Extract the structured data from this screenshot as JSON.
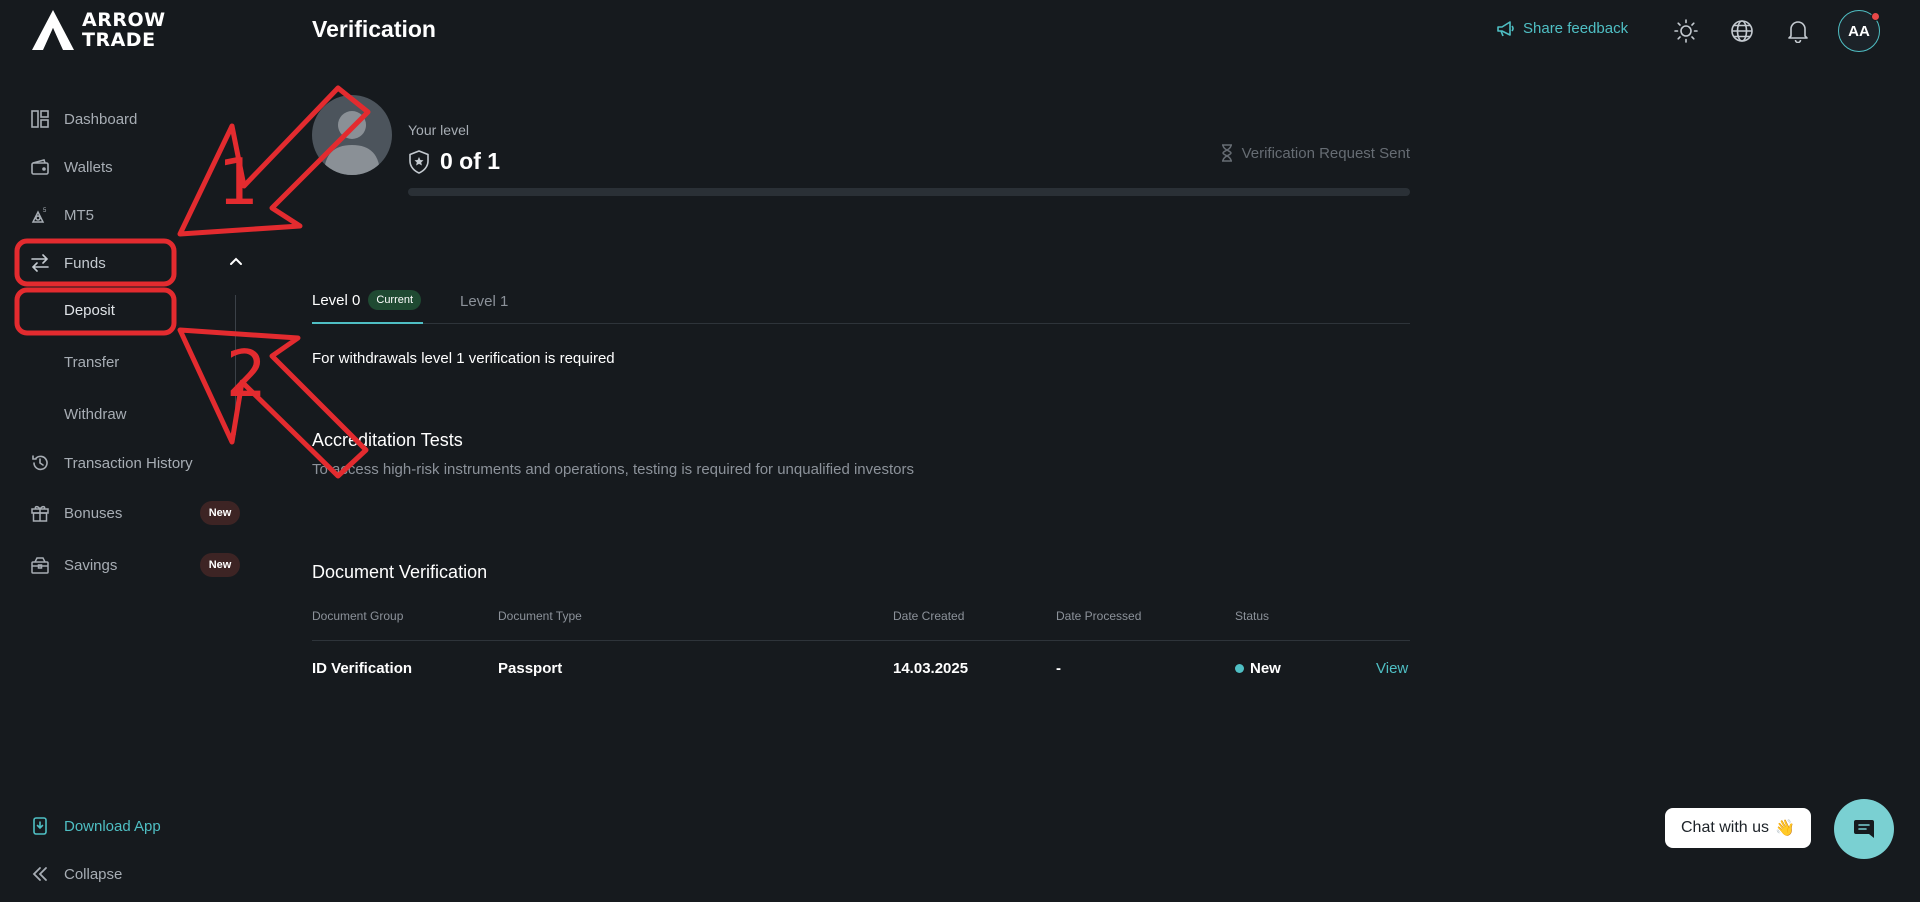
{
  "brand": {
    "logo_text": "ARROW\nTRADE"
  },
  "sidebar": {
    "items": [
      {
        "label": "Dashboard",
        "icon": "dashboard-icon"
      },
      {
        "label": "Wallets",
        "icon": "wallet-icon"
      },
      {
        "label": "MT5",
        "icon": "mt5-icon"
      },
      {
        "label": "Funds",
        "icon": "transfer-arrows-icon"
      },
      {
        "label": "Transaction History",
        "icon": "history-icon"
      },
      {
        "label": "Bonuses",
        "icon": "gift-icon",
        "badge": "New"
      },
      {
        "label": "Savings",
        "icon": "savings-icon",
        "badge": "New"
      }
    ],
    "funds_sub": [
      "Deposit",
      "Transfer",
      "Withdraw"
    ],
    "download_app": "Download App",
    "collapse": "Collapse"
  },
  "header": {
    "title": "Verification",
    "share_feedback": "Share feedback",
    "avatar_initials": "AA"
  },
  "level": {
    "your_level_label": "Your level",
    "value": "0 of 1",
    "progress": 0,
    "request_status": "Verification Request Sent"
  },
  "tabs": [
    {
      "label": "Level 0",
      "badge": "Current"
    },
    {
      "label": "Level 1"
    }
  ],
  "notice": "For withdrawals level 1 verification is required",
  "accreditation": {
    "title": "Accreditation Tests",
    "subtitle": "To access high-risk instruments and operations, testing is required for unqualified investors"
  },
  "documents": {
    "title": "Document Verification",
    "columns": [
      "Document Group",
      "Document Type",
      "Date Created",
      "Date Processed",
      "Status"
    ],
    "rows": [
      {
        "group": "ID Verification",
        "type": "Passport",
        "created": "14.03.2025",
        "processed": "-",
        "status": "New",
        "action": "View"
      }
    ]
  },
  "chat": {
    "label": "Chat with us",
    "emoji": "👋"
  },
  "annotations": {
    "marker_1": "1",
    "marker_2": "2"
  },
  "colors": {
    "accent": "#4fbfc4",
    "annotation": "#e32b2f",
    "background": "#161a1e"
  }
}
